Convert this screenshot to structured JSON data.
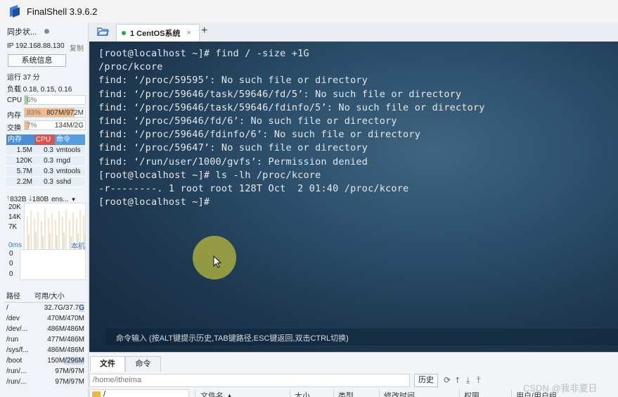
{
  "window": {
    "title": "FinalShell 3.9.6.2"
  },
  "sidebar": {
    "sync_status": "同步状...",
    "ip": "IP 192.168.88.130",
    "copy_label": "复制",
    "sysinfo_button": "系统信息",
    "uptime": "运行 37 分",
    "load": "负载 0.18, 0.15, 0.16",
    "cpu": {
      "label": "CPU",
      "percent_text": "6%",
      "fraction": 0.06,
      "color": "#9fd39a"
    },
    "memory": {
      "label": "内存",
      "percent_text": "83%",
      "value_text": "807M/972M",
      "fraction": 0.83,
      "color": "#f2b98a"
    },
    "swap": {
      "label": "交换",
      "percent_text": "7%",
      "value_text": "134M/2G",
      "fraction": 0.07,
      "color": "#f2b98a"
    },
    "process_table": {
      "headers": [
        "内存",
        "CPU",
        "命令"
      ],
      "rows": [
        {
          "mem": "1.5M",
          "cpu": "0.3",
          "cmd": "vmtools"
        },
        {
          "mem": "120K",
          "cpu": "0.3",
          "cmd": "rngd"
        },
        {
          "mem": "5.7M",
          "cpu": "0.3",
          "cmd": "vmtools"
        },
        {
          "mem": "2.2M",
          "cpu": "0.3",
          "cmd": "sshd"
        }
      ]
    },
    "network": {
      "up": "832B",
      "down": "180B",
      "interface": "ens...",
      "ticks": [
        "20K",
        "14K",
        "7K"
      ]
    },
    "latency": {
      "ms": "0ms",
      "host": "本机",
      "values": [
        "0",
        "0",
        "0"
      ]
    },
    "disk_table": {
      "headers": [
        "路径",
        "可用/大小"
      ],
      "rows": [
        {
          "path": "/",
          "size": "32.7G/37.7G",
          "used_fraction": 0.13
        },
        {
          "path": "/dev",
          "size": "470M/470M",
          "used_fraction": 0.0
        },
        {
          "path": "/dev/...",
          "size": "486M/486M",
          "used_fraction": 0.0
        },
        {
          "path": "/run",
          "size": "477M/486M",
          "used_fraction": 0.02
        },
        {
          "path": "/sys/f...",
          "size": "486M/486M",
          "used_fraction": 0.0
        },
        {
          "path": "/boot",
          "size": "150M/296M",
          "used_fraction": 0.49
        },
        {
          "path": "/run/...",
          "size": "97M/97M",
          "used_fraction": 0.0
        },
        {
          "path": "/run/...",
          "size": "97M/97M",
          "used_fraction": 0.0
        }
      ]
    }
  },
  "tabs": {
    "session_label": "1 CentOS系统",
    "add_label": "+",
    "close_label": "×"
  },
  "terminal": {
    "lines": [
      "[root@localhost ~]# find / -size +1G",
      "/proc/kcore",
      "find: ‘/proc/59595’: No such file or directory",
      "find: ‘/proc/59646/task/59646/fd/5’: No such file or directory",
      "find: ‘/proc/59646/task/59646/fdinfo/5’: No such file or directory",
      "find: ‘/proc/59646/fd/6’: No such file or directory",
      "find: ‘/proc/59646/fdinfo/6’: No such file or directory",
      "find: ‘/proc/59647’: No such file or directory",
      "find: ‘/run/user/1000/gvfs’: Permission denied",
      "[root@localhost ~]# ls -lh /proc/kcore",
      "-r--------. 1 root root 128T Oct  2 01:40 /proc/kcore",
      "[root@localhost ~]#"
    ],
    "command_input_hint": "命令输入 (按ALT键提示历史,TAB键路径,ESC键返回,双击CTRL切换)",
    "resize_handle": "....."
  },
  "file_panel": {
    "tabs": [
      "文件",
      "命令"
    ],
    "path": "/home/itheima",
    "history_button": "历史",
    "tree_root": "/",
    "columns": [
      "文件名 ▲",
      "大小",
      "类型",
      "修改时间",
      "权限",
      "用户/用户组"
    ]
  },
  "watermark": "CSDN @我非夏日"
}
